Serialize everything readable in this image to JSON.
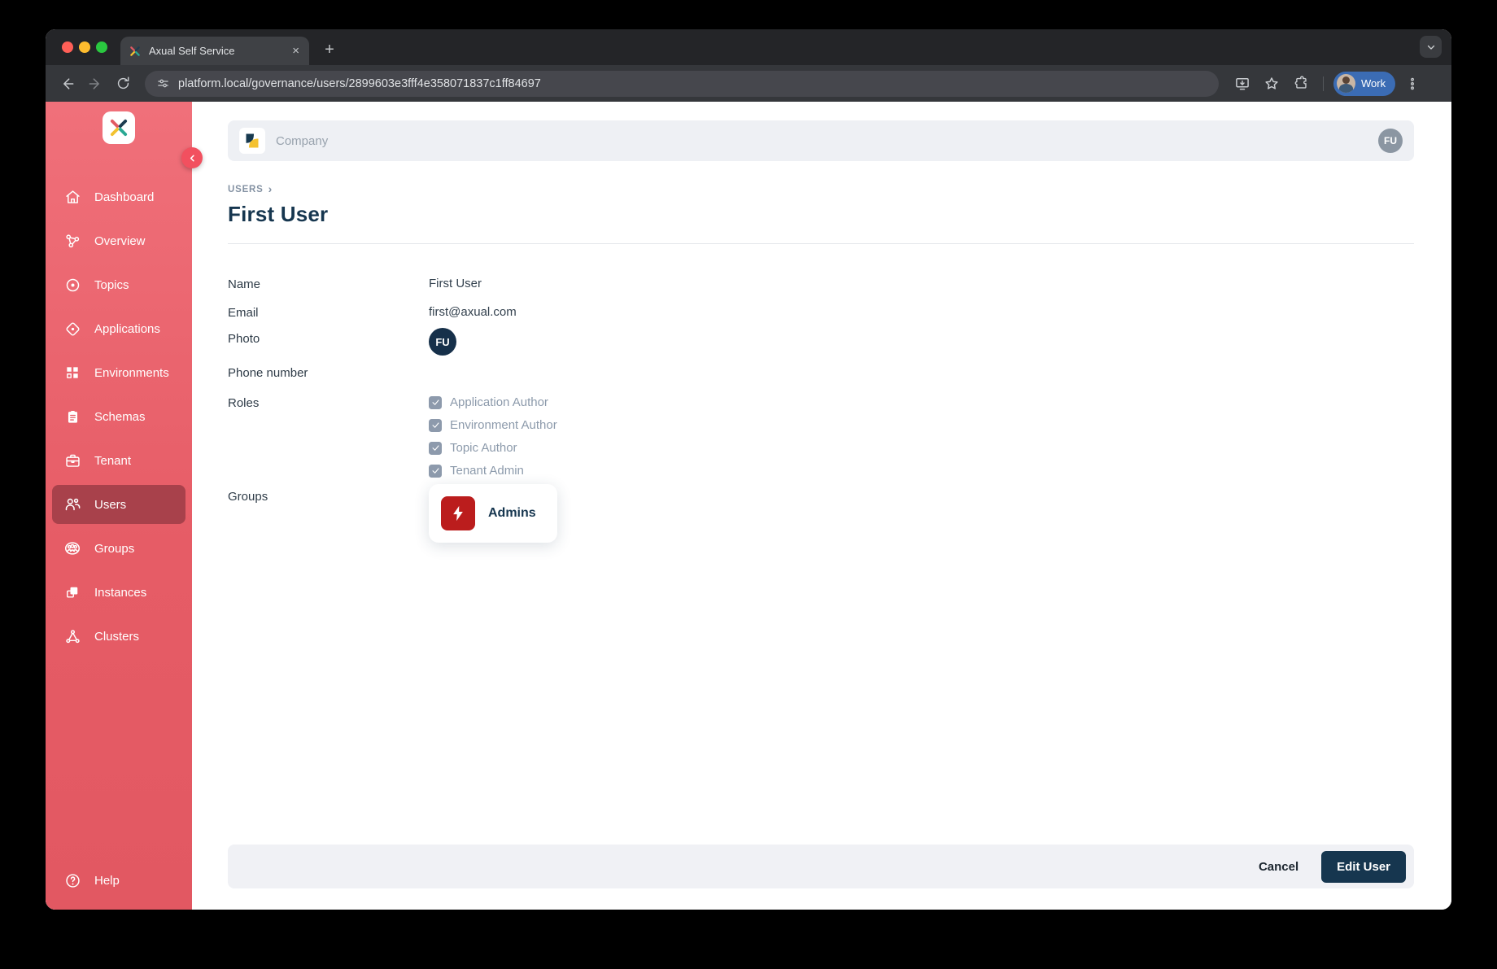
{
  "browser": {
    "tab_title": "Axual Self Service",
    "tab_close_glyph": "×",
    "new_tab_glyph": "+",
    "url": "platform.local/governance/users/2899603e3fff4e358071837c1ff84697",
    "profile_label": "Work"
  },
  "sidebar": {
    "items": [
      {
        "id": "dashboard",
        "icon": "home",
        "label": "Dashboard",
        "active": false
      },
      {
        "id": "overview",
        "icon": "nodes",
        "label": "Overview",
        "active": false
      },
      {
        "id": "topics",
        "icon": "record",
        "label": "Topics",
        "active": false
      },
      {
        "id": "applications",
        "icon": "diamond",
        "label": "Applications",
        "active": false
      },
      {
        "id": "environments",
        "icon": "grid",
        "label": "Environments",
        "active": false
      },
      {
        "id": "schemas",
        "icon": "clipboard",
        "label": "Schemas",
        "active": false
      },
      {
        "id": "tenant",
        "icon": "briefcase",
        "label": "Tenant",
        "active": false
      },
      {
        "id": "users",
        "icon": "users",
        "label": "Users",
        "active": true
      },
      {
        "id": "groups",
        "icon": "group",
        "label": "Groups",
        "active": false
      },
      {
        "id": "instances",
        "icon": "instances",
        "label": "Instances",
        "active": false
      },
      {
        "id": "clusters",
        "icon": "cluster",
        "label": "Clusters",
        "active": false
      }
    ],
    "help": {
      "id": "help",
      "icon": "help",
      "label": "Help"
    }
  },
  "header": {
    "company_label": "Company",
    "avatar_initials": "FU"
  },
  "breadcrumb": {
    "root": "USERS",
    "chevron": "›"
  },
  "page": {
    "title": "First User"
  },
  "form": {
    "name": {
      "label": "Name",
      "value": "First User"
    },
    "email": {
      "label": "Email",
      "value": "first@axual.com"
    },
    "photo": {
      "label": "Photo",
      "initials": "FU"
    },
    "phone": {
      "label": "Phone number",
      "value": ""
    },
    "roles": {
      "label": "Roles",
      "options": [
        {
          "label": "Application Author",
          "checked": true
        },
        {
          "label": "Environment Author",
          "checked": true
        },
        {
          "label": "Topic Author",
          "checked": true
        },
        {
          "label": "Tenant Admin",
          "checked": true
        }
      ]
    },
    "groups": {
      "label": "Groups",
      "items": [
        {
          "name": "Admins",
          "icon": "lightning"
        }
      ]
    }
  },
  "footer": {
    "cancel_label": "Cancel",
    "submit_label": "Edit User"
  },
  "colors": {
    "sidebar": "#e85d66",
    "sidebar_active": "#a8414b",
    "navy": "#16364f",
    "group_icon_red": "#bb1d1d",
    "muted_role": "#8c9aab",
    "bar_bg": "#eef0f4",
    "profile_chip_blue": "#3b6cb4"
  }
}
